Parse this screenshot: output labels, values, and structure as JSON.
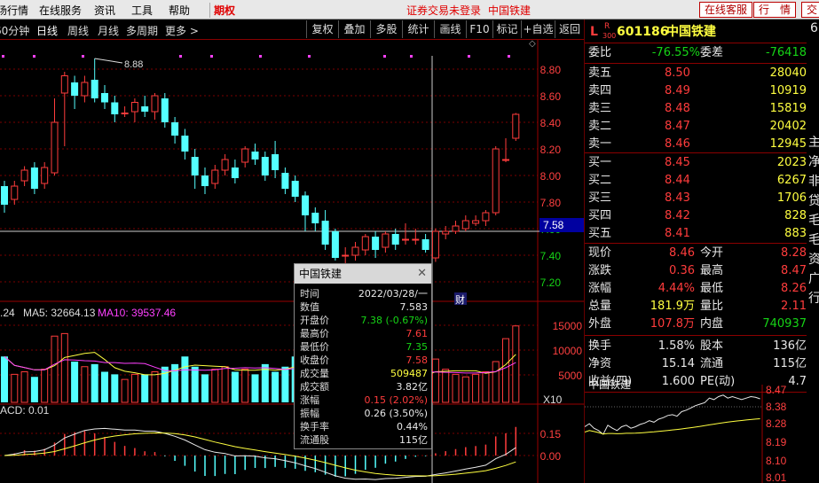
{
  "menu": {
    "items": [
      "场行情",
      "在线服务",
      "资讯",
      "工具",
      "帮助"
    ],
    "period_right": "期权",
    "notice": "证券交易未登录",
    "notice_stock": "中国铁建",
    "service_btn": "在线客服",
    "quote_btn": "行　情",
    "trade_btn": "交"
  },
  "toolbar": {
    "periods": [
      "60分钟",
      "日线",
      "周线",
      "月线",
      "多周期",
      "更多 >"
    ],
    "active_period": "日线",
    "buttons": [
      "复权",
      "叠加",
      "多股",
      "统计",
      "画线",
      "F10",
      "标记",
      "+自选",
      "返回"
    ]
  },
  "chart": {
    "high_label": "8.88",
    "crosshair_price": "7.58",
    "price_ticks": [
      "8.80",
      "8.60",
      "8.40",
      "8.20",
      "8.00",
      "7.80",
      "7.60",
      "7.40",
      "7.20"
    ],
    "cai_marker": "财",
    "vol_ma_label": ".24",
    "ma5_label": "MA5: 32664.13",
    "ma10_label": "MA10: 39537.46",
    "vol_ticks": [
      "15000",
      "10000",
      "5000"
    ],
    "vol_unit": "X10",
    "macd_label": "ACD: 0.01",
    "macd_ticks": [
      "0.15",
      "0.00"
    ],
    "candles": [
      {
        "o": 7.92,
        "c": 7.78,
        "h": 7.96,
        "l": 7.72
      },
      {
        "o": 7.82,
        "c": 7.92,
        "h": 7.96,
        "l": 7.78
      },
      {
        "o": 7.96,
        "c": 8.04,
        "h": 8.07,
        "l": 7.92
      },
      {
        "o": 8.06,
        "c": 7.9,
        "h": 8.1,
        "l": 7.86
      },
      {
        "o": 7.94,
        "c": 8.06,
        "h": 8.1,
        "l": 7.9
      },
      {
        "o": 8.02,
        "c": 8.4,
        "h": 8.58,
        "l": 8.0
      },
      {
        "o": 8.62,
        "c": 8.75,
        "h": 8.78,
        "l": 8.22
      },
      {
        "o": 8.7,
        "c": 8.6,
        "h": 8.75,
        "l": 8.5
      },
      {
        "o": 8.6,
        "c": 8.7,
        "h": 8.75,
        "l": 8.55
      },
      {
        "o": 8.72,
        "c": 8.58,
        "h": 8.88,
        "l": 8.55
      },
      {
        "o": 8.62,
        "c": 8.55,
        "h": 8.68,
        "l": 8.5
      },
      {
        "o": 8.55,
        "c": 8.46,
        "h": 8.6,
        "l": 8.4
      },
      {
        "o": 8.47,
        "c": 8.47,
        "h": 8.52,
        "l": 8.44
      },
      {
        "o": 8.48,
        "c": 8.55,
        "h": 8.58,
        "l": 8.4
      },
      {
        "o": 8.52,
        "c": 8.48,
        "h": 8.6,
        "l": 8.44
      },
      {
        "o": 8.48,
        "c": 8.6,
        "h": 8.62,
        "l": 8.42
      },
      {
        "o": 8.58,
        "c": 8.4,
        "h": 8.62,
        "l": 8.36
      },
      {
        "o": 8.4,
        "c": 8.3,
        "h": 8.44,
        "l": 8.24
      },
      {
        "o": 8.3,
        "c": 8.18,
        "h": 8.35,
        "l": 8.12
      },
      {
        "o": 8.14,
        "c": 8.0,
        "h": 8.2,
        "l": 7.9
      },
      {
        "o": 8.0,
        "c": 7.92,
        "h": 8.06,
        "l": 7.86
      },
      {
        "o": 7.94,
        "c": 8.04,
        "h": 8.08,
        "l": 7.9
      },
      {
        "o": 8.04,
        "c": 8.12,
        "h": 8.16,
        "l": 8.0
      },
      {
        "o": 8.06,
        "c": 7.98,
        "h": 8.12,
        "l": 7.94
      },
      {
        "o": 8.1,
        "c": 8.2,
        "h": 8.22,
        "l": 8.06
      },
      {
        "o": 8.18,
        "c": 8.12,
        "h": 8.24,
        "l": 8.08
      },
      {
        "o": 8.14,
        "c": 8.0,
        "h": 8.18,
        "l": 7.96
      },
      {
        "o": 8.16,
        "c": 8.04,
        "h": 8.26,
        "l": 7.98
      },
      {
        "o": 8.02,
        "c": 7.9,
        "h": 8.06,
        "l": 7.86
      },
      {
        "o": 7.96,
        "c": 7.84,
        "h": 8.0,
        "l": 7.8
      },
      {
        "o": 7.85,
        "c": 7.7,
        "h": 7.88,
        "l": 7.58
      },
      {
        "o": 7.72,
        "c": 7.64,
        "h": 7.76,
        "l": 7.58
      },
      {
        "o": 7.66,
        "c": 7.48,
        "h": 7.74,
        "l": 7.44
      },
      {
        "o": 7.58,
        "c": 7.38,
        "h": 7.6,
        "l": 7.36
      },
      {
        "o": 7.4,
        "c": 7.4,
        "h": 7.46,
        "l": 7.34
      },
      {
        "o": 7.4,
        "c": 7.46,
        "h": 7.5,
        "l": 7.36
      },
      {
        "o": 7.44,
        "c": 7.54,
        "h": 7.56,
        "l": 7.4
      },
      {
        "o": 7.54,
        "c": 7.44,
        "h": 7.58,
        "l": 7.38
      },
      {
        "o": 7.46,
        "c": 7.56,
        "h": 7.58,
        "l": 7.42
      },
      {
        "o": 7.56,
        "c": 7.48,
        "h": 7.6,
        "l": 7.44
      },
      {
        "o": 7.52,
        "c": 7.52,
        "h": 7.64,
        "l": 7.48
      },
      {
        "o": 7.52,
        "c": 7.52,
        "h": 7.6,
        "l": 7.48
      },
      {
        "o": 7.52,
        "c": 7.44,
        "h": 7.56,
        "l": 7.42
      },
      {
        "o": 7.38,
        "c": 7.58,
        "h": 7.6,
        "l": 7.35
      },
      {
        "o": 7.56,
        "c": 7.58,
        "h": 7.62,
        "l": 7.52
      },
      {
        "o": 7.58,
        "c": 7.62,
        "h": 7.66,
        "l": 7.56
      },
      {
        "o": 7.6,
        "c": 7.66,
        "h": 7.7,
        "l": 7.58
      },
      {
        "o": 7.64,
        "c": 7.66,
        "h": 7.7,
        "l": 7.62
      },
      {
        "o": 7.66,
        "c": 7.72,
        "h": 7.74,
        "l": 7.62
      },
      {
        "o": 7.72,
        "c": 8.2,
        "h": 8.22,
        "l": 7.7
      },
      {
        "o": 8.12,
        "c": 8.12,
        "h": 8.28,
        "l": 8.1
      },
      {
        "o": 8.28,
        "c": 8.46,
        "h": 8.47,
        "l": 8.26
      }
    ],
    "volumes": [
      90,
      55,
      60,
      50,
      65,
      130,
      135,
      80,
      70,
      75,
      60,
      55,
      45,
      55,
      55,
      60,
      70,
      75,
      90,
      70,
      55,
      65,
      70,
      60,
      65,
      55,
      75,
      60,
      70,
      90,
      110,
      95,
      80,
      85,
      70,
      60,
      60,
      55,
      50,
      60,
      50,
      50,
      55,
      85,
      65,
      55,
      50,
      55,
      60,
      80,
      125,
      150
    ],
    "vol_max": 160
  },
  "popup": {
    "title": "中国铁建",
    "rows": [
      {
        "k": "时间",
        "v": "2022/03/28/一",
        "c": "white"
      },
      {
        "k": "数值",
        "v": "7.583",
        "c": "white"
      },
      {
        "k": "开盘价",
        "v": "7.38 (-0.67%)",
        "c": "green"
      },
      {
        "k": "最高价",
        "v": "7.61",
        "c": "red"
      },
      {
        "k": "最低价",
        "v": "7.35",
        "c": "green"
      },
      {
        "k": "收盘价",
        "v": "7.58",
        "c": "red"
      },
      {
        "k": "成交量",
        "v": "509487",
        "c": "yellow"
      },
      {
        "k": "成交额",
        "v": "3.82亿",
        "c": "white"
      },
      {
        "k": "涨幅",
        "v": "0.15 (2.02%)",
        "c": "red"
      },
      {
        "k": "振幅",
        "v": "0.26 (3.50%)",
        "c": "white"
      },
      {
        "k": "换手率",
        "v": "0.44%",
        "c": "white"
      },
      {
        "k": "流通股",
        "v": "115亿",
        "c": "white"
      }
    ]
  },
  "panel": {
    "l_label": "L",
    "r_label": "R",
    "r_sub": "300",
    "code": "601186",
    "name": "中国铁建",
    "edge_char": "6",
    "weibi_label": "委比",
    "weibi": "-76.55%",
    "weicha_label": "委差",
    "weicha": "-76418",
    "asks": [
      {
        "label": "卖五",
        "price": "8.50",
        "vol": "28040"
      },
      {
        "label": "卖四",
        "price": "8.49",
        "vol": "10919"
      },
      {
        "label": "卖三",
        "price": "8.48",
        "vol": "15819"
      },
      {
        "label": "卖二",
        "price": "8.47",
        "vol": "20402"
      },
      {
        "label": "卖一",
        "price": "8.46",
        "vol": "12945"
      }
    ],
    "bids": [
      {
        "label": "买一",
        "price": "8.45",
        "vol": "2023"
      },
      {
        "label": "买二",
        "price": "8.44",
        "vol": "6267"
      },
      {
        "label": "买三",
        "price": "8.43",
        "vol": "1706"
      },
      {
        "label": "买四",
        "price": "8.42",
        "vol": "828"
      },
      {
        "label": "买五",
        "price": "8.41",
        "vol": "883"
      }
    ],
    "stats1": [
      {
        "k1": "现价",
        "v1": "8.46",
        "c1": "red",
        "k2": "今开",
        "v2": "8.28",
        "c2": "red"
      },
      {
        "k1": "涨跌",
        "v1": "0.36",
        "c1": "red",
        "k2": "最高",
        "v2": "8.47",
        "c2": "red"
      },
      {
        "k1": "涨幅",
        "v1": "4.44%",
        "c1": "red",
        "k2": "最低",
        "v2": "8.26",
        "c2": "red"
      },
      {
        "k1": "总量",
        "v1": "181.9万",
        "c1": "yellow",
        "k2": "量比",
        "v2": "2.11",
        "c2": "red"
      },
      {
        "k1": "外盘",
        "v1": "107.8万",
        "c1": "red",
        "k2": "内盘",
        "v2": "740937",
        "c2": "green"
      }
    ],
    "stats2": [
      {
        "k1": "换手",
        "v1": "1.58%",
        "c1": "white",
        "k2": "股本",
        "v2": "136亿",
        "c2": "white"
      },
      {
        "k1": "净资",
        "v1": "15.14",
        "c1": "white",
        "k2": "流通",
        "v2": "115亿",
        "c2": "white"
      },
      {
        "k1": "收益(四)",
        "v1": "1.600",
        "c1": "white",
        "k2": "PE(动)",
        "v2": "4.7",
        "c2": "white"
      }
    ],
    "mini_title": "中国铁建",
    "mini_ticks": [
      "8.47",
      "8.38",
      "8.28",
      "8.19",
      "8.10",
      "8.01"
    ],
    "edge_chars": [
      "主",
      "净",
      "非",
      "贷",
      "毛",
      "毛",
      "资",
      "广",
      "行"
    ]
  }
}
